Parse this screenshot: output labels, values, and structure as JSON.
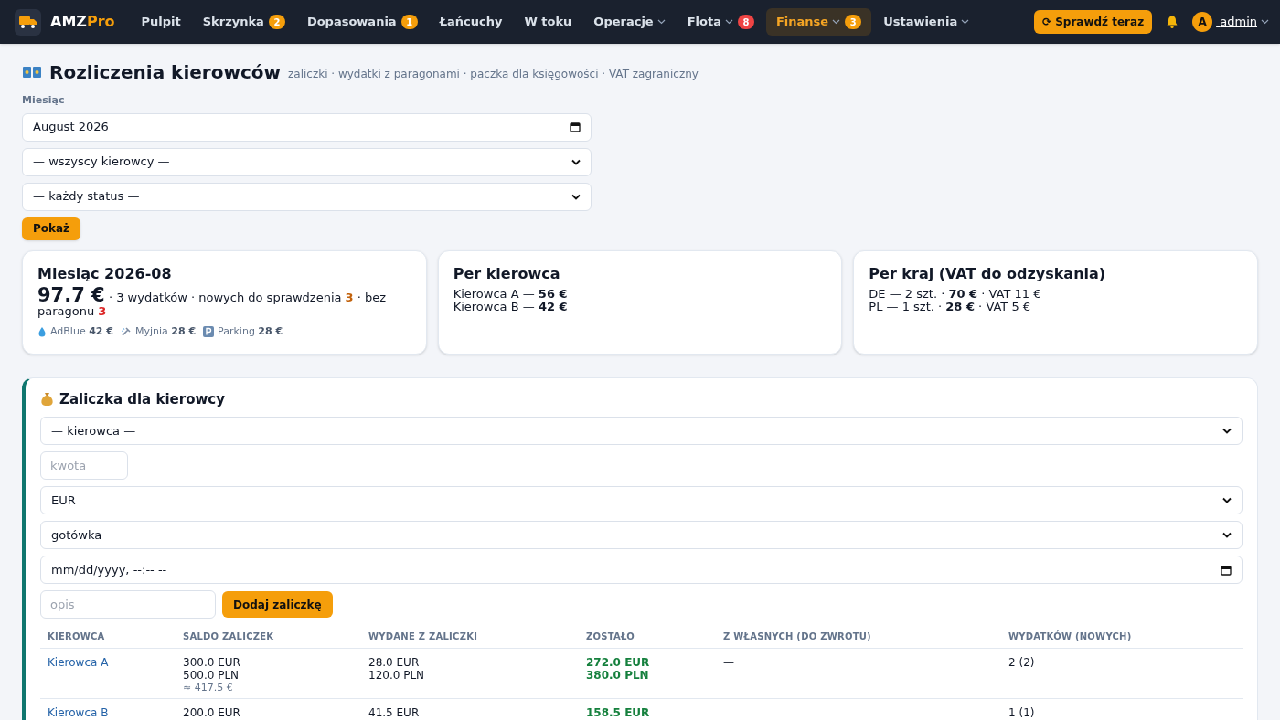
{
  "nav": {
    "brand_left": "AMZ",
    "brand_right": "Pro",
    "items": [
      {
        "label": "Pulpit",
        "selected": false
      },
      {
        "label": "Skrzynka",
        "selected": false,
        "badge": "2",
        "color": "#f59e0b"
      },
      {
        "label": "Dopasowania",
        "selected": false,
        "badge": "1",
        "color": "#f59e0b"
      },
      {
        "label": "Łańcuchy",
        "selected": false
      },
      {
        "label": "W toku",
        "selected": false
      },
      {
        "label": "Operacje",
        "selected": false,
        "dropdown": true
      },
      {
        "label": "Flota",
        "selected": false,
        "dropdown": true,
        "badge": "8",
        "color": "#ef4444"
      },
      {
        "label": "Finanse",
        "selected": true,
        "dropdown": true,
        "badge": "3",
        "color": "#f59e0b"
      },
      {
        "label": "Ustawienia",
        "selected": false,
        "dropdown": true
      }
    ],
    "check_button": "⟳ Sprawdź teraz",
    "avatar": "A",
    "user": "admin"
  },
  "page": {
    "title": "Rozliczenia kierowców",
    "subtitle": "zaliczki · wydatki z paragonami · paczka dla księgowości · VAT zagraniczny"
  },
  "filters": {
    "month_label": "Miesiąc",
    "month_value": "August 2026",
    "driver": "— wszyscy kierowcy —",
    "status": "— każdy status —",
    "submit": "Pokaż"
  },
  "summary": {
    "title": "Miesiąc 2026-08",
    "total": "97.7 €",
    "line_parts": [
      " · 3 wydatków · nowych do sprawdzenia ",
      "3",
      " · bez paragonu ",
      "3"
    ],
    "categories": [
      {
        "kind": "drop",
        "label": "AdBlue",
        "amount": "42 €"
      },
      {
        "kind": "wash",
        "label": "Myjnia",
        "amount": "28 €"
      },
      {
        "kind": "parking",
        "label": "Parking",
        "amount": "28 €"
      }
    ]
  },
  "per_driver": {
    "title": "Per kierowca",
    "lines": [
      "Kierowca A — **56 €**",
      "Kierowca B — **42 €**"
    ]
  },
  "per_country": {
    "title": "Per kraj (VAT do odzyskania)",
    "lines": [
      "DE — 2 szt. · **70 €** · VAT 11 €",
      "PL — 1 szt. · **28 €** · VAT 5 €"
    ]
  },
  "advance": {
    "title": "Zaliczka dla kierowcy",
    "driver": "— kierowca —",
    "amount_placeholder": "kwota",
    "currency": "EUR",
    "method": "gotówka",
    "datetime": "mm/dd/yyyy, --:-- --",
    "description_placeholder": "opis",
    "submit": "Dodaj zaliczkę"
  },
  "table": {
    "columns": [
      "KIEROWCA",
      "SALDO ZALICZEK",
      "WYDANE Z ZALICZKI",
      "ZOSTAŁO",
      "Z WŁASNYCH (DO ZWROTU)",
      "WYDATKÓW (NOWYCH)"
    ],
    "rows": [
      {
        "driver": "Kierowca A",
        "balance": [
          "300.0 EUR",
          "500.0 PLN"
        ],
        "balance_approx": "≈ 417.5 €",
        "spent": [
          "28.0 EUR",
          "120.0 PLN"
        ],
        "left": [
          "272.0 EUR",
          "380.0 PLN"
        ],
        "own": "—",
        "expenses": "2 (2)"
      },
      {
        "driver": "Kierowca B",
        "balance": [
          "200.0 EUR"
        ],
        "spent": [
          "41.5 EUR"
        ],
        "left": [
          "158.5 EUR"
        ],
        "expenses": "1 (1)"
      }
    ]
  }
}
